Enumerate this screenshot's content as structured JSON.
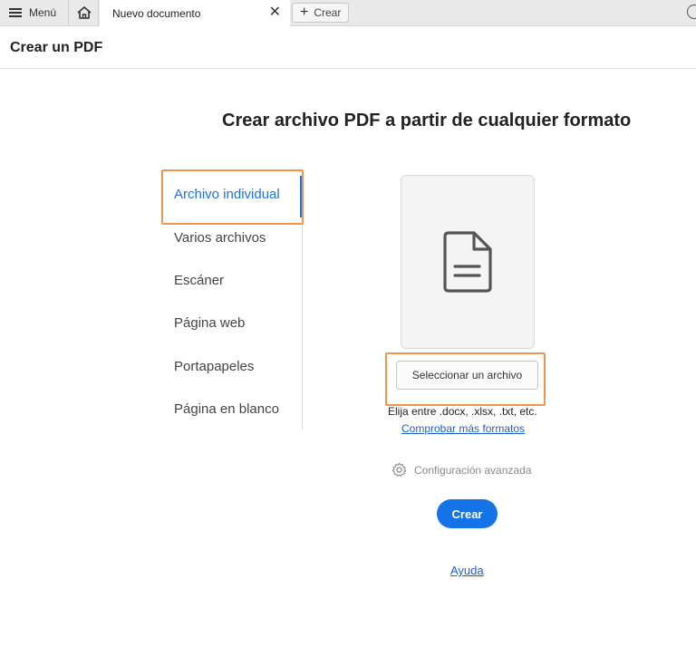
{
  "tabbar": {
    "menu_label": "Menú",
    "home_icon": "home-icon",
    "doc_tab_label": "Nuevo documento",
    "close_glyph": "✕",
    "new_tab_label": "Crear"
  },
  "header": {
    "title": "Crear un PDF"
  },
  "main": {
    "title": "Crear archivo PDF a partir de cualquier formato",
    "nav": {
      "items": [
        {
          "label": "Archivo individual",
          "active": true
        },
        {
          "label": "Varios archivos"
        },
        {
          "label": "Escáner"
        },
        {
          "label": "Página web"
        },
        {
          "label": "Portapapeles"
        },
        {
          "label": "Página en blanco"
        }
      ]
    },
    "select_button": "Seleccionar un archivo",
    "hint": "Elija entre .docx, .xlsx, .txt, etc.",
    "more_formats": "Comprobar más formatos",
    "advanced": "Configuración avanzada",
    "create_button": "Crear",
    "help": "Ayuda"
  },
  "colors": {
    "accent": "#1473e6",
    "highlight": "#f0954b",
    "link": "#1a5fcc"
  }
}
